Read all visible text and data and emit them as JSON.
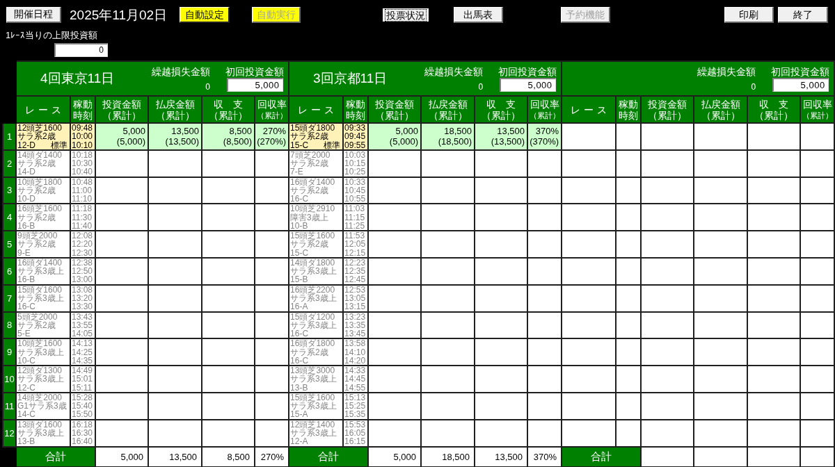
{
  "schedule_button": "開催日程",
  "date": "2025年11月02日",
  "buttons": [
    {
      "label": "自動設定",
      "color": "#ffff00",
      "disabled": false,
      "focused": false
    },
    {
      "label": "自動実行",
      "color": "#ffff00",
      "disabled": true,
      "focused": false
    },
    {
      "label": "投票状況",
      "color": "#f0f0f0",
      "disabled": false,
      "focused": true
    },
    {
      "label": "出馬表",
      "color": "#f0f0f0",
      "disabled": false,
      "focused": false
    },
    {
      "label": "予約機能",
      "color": "#f0f0f0",
      "disabled": true,
      "focused": false
    },
    {
      "label": "印刷",
      "color": "#f0f0f0",
      "disabled": false,
      "focused": false
    },
    {
      "label": "終了",
      "color": "#f0f0f0",
      "disabled": false,
      "focused": false
    }
  ],
  "limit": {
    "label": "1ﾚｰｽ当りの上限投資額",
    "value": "0"
  },
  "row_numbers": [
    "1",
    "2",
    "3",
    "4",
    "5",
    "6",
    "7",
    "8",
    "9",
    "10",
    "11",
    "12"
  ],
  "sections": [
    {
      "title": "4回東京11日",
      "carryover": {
        "label": "繰越損失金額",
        "value": "0"
      },
      "initial": {
        "label": "初回投資金額",
        "value": "5,000"
      },
      "columns": [
        {
          "lines": [
            "レース"
          ]
        },
        {
          "lines": [
            "稼動",
            "時刻"
          ]
        },
        {
          "lines": [
            "投資金額",
            "（累計）"
          ]
        },
        {
          "lines": [
            "払戻金額",
            "（累計）"
          ]
        },
        {
          "lines": [
            "収　支",
            "（累計）"
          ]
        },
        {
          "lines": [
            "回収率",
            "（累計）"
          ]
        }
      ],
      "races": [
        {
          "active": true,
          "course": "12頭芝1600",
          "class": "サラ系2歳",
          "code": "12-D",
          "grade": "標準",
          "times": [
            "09:48",
            "10:00",
            "10:10"
          ],
          "amounts": [
            {
              "value": "5,000",
              "cumulative": "(5,000)"
            },
            {
              "value": "13,500",
              "cumulative": "(13,500)"
            },
            {
              "value": "8,500",
              "cumulative": "(8,500)"
            },
            {
              "value": "270%",
              "cumulative": "(270%)"
            }
          ]
        },
        {
          "active": false,
          "course": "14頭ダ1400",
          "class": "サラ系2歳",
          "code": "14-D",
          "times": [
            "10:18",
            "10:30",
            "10:40"
          ]
        },
        {
          "active": false,
          "course": "10頭芝1800",
          "class": "サラ系2歳",
          "code": "10-D",
          "times": [
            "10:48",
            "11:00",
            "11:10"
          ]
        },
        {
          "active": false,
          "course": "16頭芝1600",
          "class": "サラ系2歳",
          "code": "16-B",
          "times": [
            "11:18",
            "11:30",
            "11:40"
          ]
        },
        {
          "active": false,
          "course": "9頭芝2000",
          "class": "サラ系2歳",
          "code": "9-E",
          "times": [
            "12:08",
            "12:20",
            "12:30"
          ]
        },
        {
          "active": false,
          "course": "16頭ダ1400",
          "class": "サラ系3歳上",
          "code": "16-B",
          "times": [
            "12:38",
            "12:50",
            "13:00"
          ]
        },
        {
          "active": false,
          "course": "15頭ダ1600",
          "class": "サラ系3歳上",
          "code": "16-C",
          "times": [
            "13:08",
            "13:20",
            "13:30"
          ]
        },
        {
          "active": false,
          "course": "5頭芝2000",
          "class": "サラ系2歳",
          "code": "5-E",
          "times": [
            "13:43",
            "13:55",
            "14:05"
          ]
        },
        {
          "active": false,
          "course": "10頭芝1600",
          "class": "サラ系3歳上",
          "code": "10-C",
          "times": [
            "14:13",
            "14:25",
            "14:35"
          ]
        },
        {
          "active": false,
          "course": "12頭ダ1300",
          "class": "サラ系3歳上",
          "code": "12-C",
          "times": [
            "14:49",
            "15:01",
            "15:11"
          ]
        },
        {
          "active": false,
          "course": "14頭芝2000",
          "class": "G1サラ系3歳",
          "code": "14-C",
          "times": [
            "15:28",
            "15:40",
            "15:50"
          ]
        },
        {
          "active": false,
          "course": "13頭ダ1600",
          "class": "サラ系3歳上",
          "code": "13-B",
          "times": [
            "16:18",
            "16:30",
            "16:40"
          ]
        }
      ],
      "total": {
        "label": "合計",
        "values": [
          "5,000",
          "13,500",
          "8,500",
          "270%"
        ]
      }
    },
    {
      "title": "3回京都11日",
      "carryover": {
        "label": "繰越損失金額",
        "value": "0"
      },
      "initial": {
        "label": "初回投資金額",
        "value": "5,000"
      },
      "columns": [
        {
          "lines": [
            "レース"
          ]
        },
        {
          "lines": [
            "稼動",
            "時刻"
          ]
        },
        {
          "lines": [
            "投資金額",
            "（累計）"
          ]
        },
        {
          "lines": [
            "払戻金額",
            "（累計）"
          ]
        },
        {
          "lines": [
            "収　支",
            "（累計）"
          ]
        },
        {
          "lines": [
            "回収率",
            "（累計）"
          ]
        }
      ],
      "races": [
        {
          "active": true,
          "course": "15頭ダ1800",
          "class": "サラ系2歳",
          "code": "15-C",
          "grade": "標準",
          "times": [
            "09:33",
            "09:45",
            "09:55"
          ],
          "amounts": [
            {
              "value": "5,000",
              "cumulative": "(5,000)"
            },
            {
              "value": "18,500",
              "cumulative": "(18,500)"
            },
            {
              "value": "13,500",
              "cumulative": "(13,500)"
            },
            {
              "value": "370%",
              "cumulative": "(370%)"
            }
          ]
        },
        {
          "active": false,
          "course": "7頭芝2000",
          "class": "サラ系2歳",
          "code": "7-E",
          "times": [
            "10:03",
            "10:15",
            "10:25"
          ]
        },
        {
          "active": false,
          "course": "16頭ダ1400",
          "class": "サラ系2歳",
          "code": "16-C",
          "times": [
            "10:33",
            "10:45",
            "10:55"
          ]
        },
        {
          "active": false,
          "course": "10頭芝2910",
          "class": "障害3歳上",
          "code": "10-B",
          "times": [
            "11:03",
            "11:15",
            "11:25"
          ]
        },
        {
          "active": false,
          "course": "15頭芝1600",
          "class": "サラ系2歳",
          "code": "15-C",
          "times": [
            "11:53",
            "12:05",
            "12:15"
          ]
        },
        {
          "active": false,
          "course": "14頭ダ1800",
          "class": "サラ系3歳上",
          "code": "15-B",
          "times": [
            "12:23",
            "12:35",
            "12:45"
          ]
        },
        {
          "active": false,
          "course": "16頭芝2200",
          "class": "サラ系3歳上",
          "code": "16-A",
          "times": [
            "12:53",
            "13:05",
            "13:15"
          ]
        },
        {
          "active": false,
          "course": "15頭ダ1200",
          "class": "サラ系3歳上",
          "code": "16-C",
          "times": [
            "13:23",
            "13:35",
            "13:45"
          ]
        },
        {
          "active": false,
          "course": "16頭ダ1800",
          "class": "サラ系2歳",
          "code": "16-C",
          "times": [
            "13:58",
            "14:10",
            "14:20"
          ]
        },
        {
          "active": false,
          "course": "13頭芝3000",
          "class": "サラ系3歳上",
          "code": "13-B",
          "times": [
            "14:33",
            "14:45",
            "14:55"
          ]
        },
        {
          "active": false,
          "course": "15頭芝1600",
          "class": "サラ系3歳上",
          "code": "15-A",
          "times": [
            "15:13",
            "15:25",
            "15:35"
          ]
        },
        {
          "active": false,
          "course": "12頭芝1400",
          "class": "サラ系3歳上",
          "code": "12-A",
          "times": [
            "15:53",
            "16:05",
            "16:15"
          ]
        }
      ],
      "total": {
        "label": "合計",
        "values": [
          "5,000",
          "18,500",
          "13,500",
          "370%"
        ]
      }
    },
    {
      "carryover": {
        "label": "繰越損失金額",
        "value": "0"
      },
      "initial": {
        "label": "初回投資金額",
        "value": "5,000"
      },
      "columns": [
        {
          "lines": [
            "レース"
          ]
        },
        {
          "lines": [
            "稼動",
            "時刻"
          ]
        },
        {
          "lines": [
            "投資金額",
            "（累計）"
          ]
        },
        {
          "lines": [
            "払戻金額",
            "（累計）"
          ]
        },
        {
          "lines": [
            "収　支",
            "（累計）"
          ]
        },
        {
          "lines": [
            "回収率",
            "（累計）"
          ]
        }
      ],
      "total": {
        "label": "合計"
      }
    }
  ]
}
